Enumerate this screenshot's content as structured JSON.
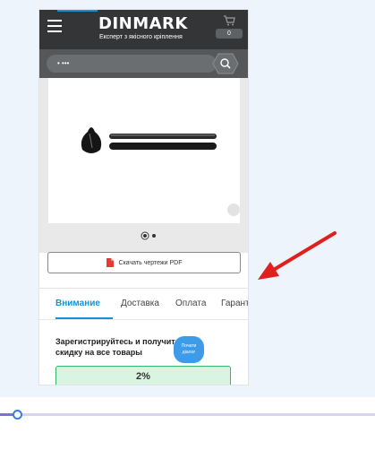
{
  "header": {
    "logo": "DINMARK",
    "tagline": "Експерт з якісного кріплення",
    "cart_count": "0"
  },
  "search": {
    "value": "• •••"
  },
  "product": {
    "gallery_slide": "1 of 2",
    "pdf_button": "Скачать чертежи PDF"
  },
  "tabs": [
    {
      "label": "Внимание",
      "active": true
    },
    {
      "label": "Доставка",
      "active": false
    },
    {
      "label": "Оплата",
      "active": false
    },
    {
      "label": "Гаранти",
      "active": false
    }
  ],
  "promo": {
    "text": "Зарегистрируйтесь и получите скидку на все товары",
    "discount": "2%"
  },
  "chat": {
    "label_line1": "Почати",
    "label_line2": "діалог"
  },
  "colors": {
    "accent": "#1b8fd4",
    "header_bg": "#333537",
    "promo_bg": "#d9f4e0",
    "annotation_arrow": "#e0201e"
  },
  "playback": {
    "progress": 0.045
  }
}
